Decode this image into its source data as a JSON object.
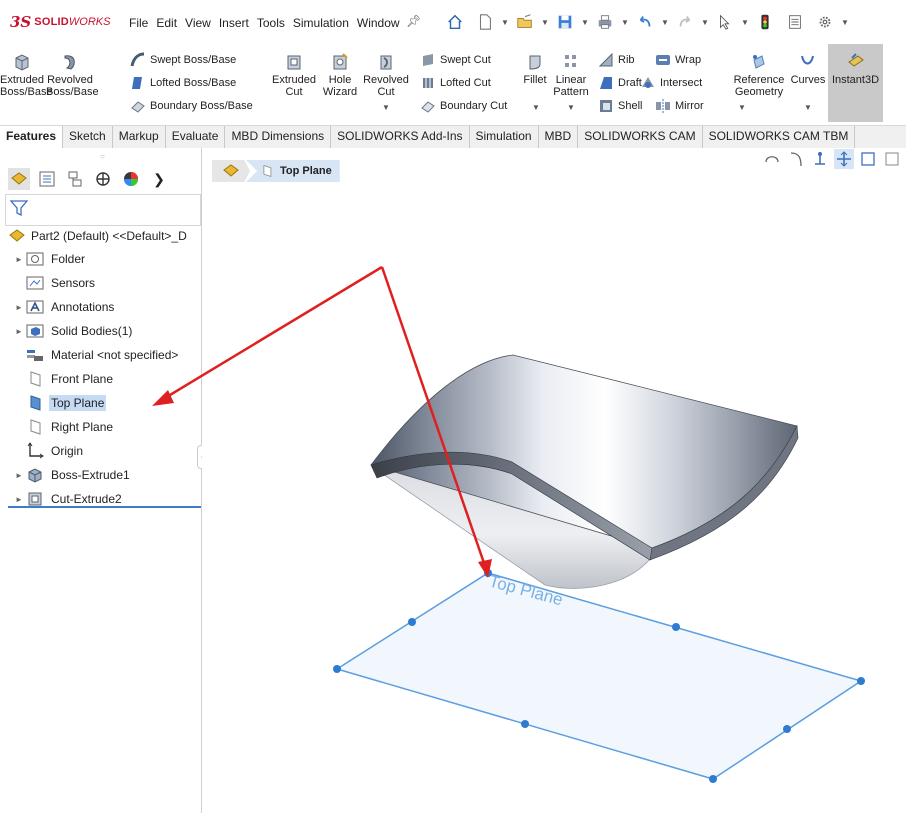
{
  "app": {
    "logo_ds": "3S",
    "logo_solid": "SOLID",
    "logo_works": "WORKS"
  },
  "menu": [
    "File",
    "Edit",
    "View",
    "Insert",
    "Tools",
    "Simulation",
    "Window"
  ],
  "command_manager": {
    "extruded_boss_1": "Extruded",
    "extruded_boss_2": "Boss/Base",
    "revolved_boss_1": "Revolved",
    "revolved_boss_2": "Boss/Base",
    "swept_boss": "Swept Boss/Base",
    "lofted_boss": "Lofted Boss/Base",
    "boundary_boss": "Boundary Boss/Base",
    "extruded_cut_1": "Extruded",
    "extruded_cut_2": "Cut",
    "hole_wizard_1": "Hole",
    "hole_wizard_2": "Wizard",
    "revolved_cut_1": "Revolved",
    "revolved_cut_2": "Cut",
    "swept_cut": "Swept Cut",
    "lofted_cut": "Lofted Cut",
    "boundary_cut": "Boundary Cut",
    "fillet": "Fillet",
    "linear_pattern_1": "Linear",
    "linear_pattern_2": "Pattern",
    "rib": "Rib",
    "draft": "Draft",
    "shell": "Shell",
    "wrap": "Wrap",
    "intersect": "Intersect",
    "mirror": "Mirror",
    "reference_geometry_1": "Reference",
    "reference_geometry_2": "Geometry",
    "curves": "Curves",
    "instant3d": "Instant3D"
  },
  "tabs": [
    {
      "label": "Features",
      "active": true
    },
    {
      "label": "Sketch",
      "active": false
    },
    {
      "label": "Markup",
      "active": false
    },
    {
      "label": "Evaluate",
      "active": false
    },
    {
      "label": "MBD Dimensions",
      "active": false
    },
    {
      "label": "SOLIDWORKS Add-Ins",
      "active": false
    },
    {
      "label": "Simulation",
      "active": false
    },
    {
      "label": "MBD",
      "active": false
    },
    {
      "label": "SOLIDWORKS CAM",
      "active": false
    },
    {
      "label": "SOLIDWORKS CAM TBM",
      "active": false
    }
  ],
  "feature_tree": {
    "root": "Part2 (Default) <<Default>_D",
    "items": [
      {
        "label": "Folder",
        "icon": "folder-icon",
        "expandable": true,
        "selected": false
      },
      {
        "label": "Sensors",
        "icon": "sensors-icon",
        "expandable": false,
        "selected": false
      },
      {
        "label": "Annotations",
        "icon": "annotations-icon",
        "expandable": true,
        "selected": false
      },
      {
        "label": "Solid Bodies(1)",
        "icon": "solid-bodies-icon",
        "expandable": true,
        "selected": false
      },
      {
        "label": "Material <not specified>",
        "icon": "material-icon",
        "expandable": false,
        "selected": false
      },
      {
        "label": "Front Plane",
        "icon": "plane-icon",
        "expandable": false,
        "selected": false
      },
      {
        "label": "Top Plane",
        "icon": "plane-icon",
        "expandable": false,
        "selected": true
      },
      {
        "label": "Right Plane",
        "icon": "plane-icon",
        "expandable": false,
        "selected": false
      },
      {
        "label": "Origin",
        "icon": "origin-icon",
        "expandable": false,
        "selected": false
      },
      {
        "label": "Boss-Extrude1",
        "icon": "boss-extrude-icon",
        "expandable": true,
        "selected": false
      },
      {
        "label": "Cut-Extrude2",
        "icon": "cut-extrude-icon",
        "expandable": true,
        "selected": false
      }
    ]
  },
  "breadcrumb": {
    "selected": "Top Plane"
  },
  "viewport": {
    "plane_label": "Top Plane"
  },
  "colors": {
    "selection_blue": "#c5dbf3",
    "plane_blue": "#4a90d9",
    "arrow_red": "#e02020",
    "logo_red": "#c8102e"
  }
}
